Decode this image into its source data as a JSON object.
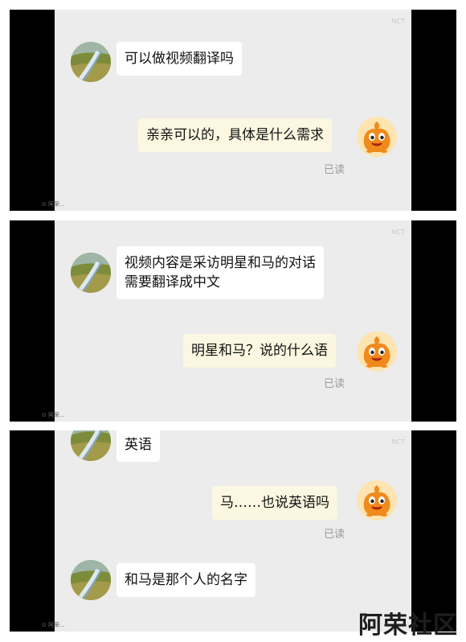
{
  "panels": [
    {
      "watermark_top": "NCT",
      "watermark_bottom": "⊙ 阿荣...",
      "messages": [
        {
          "side": "in",
          "text": "可以做视频翻译吗"
        },
        {
          "side": "out",
          "text": "亲亲可以的，具体是什么需求",
          "status": "已读"
        }
      ]
    },
    {
      "watermark_top": "NCT",
      "watermark_bottom": "⊙ 阿荣...",
      "messages": [
        {
          "side": "in",
          "line1": "视频内容是采访明星和马的对话",
          "line2": "需要翻译成中文"
        },
        {
          "side": "out",
          "text": "明星和马？说的什么语",
          "status": "已读"
        }
      ]
    },
    {
      "watermark_top": "NCT",
      "watermark_bottom": "⊙ 阿荣...",
      "messages": [
        {
          "side": "in",
          "text": "英语"
        },
        {
          "side": "out",
          "text": "马……也说英语吗",
          "status": "已读"
        },
        {
          "side": "in",
          "text": "和马是那个人的名字"
        }
      ]
    }
  ],
  "footer_brand": "阿荣社区",
  "icons": {
    "user_avatar": "landscape-avatar-icon",
    "service_avatar": "orange-mascot-avatar-icon"
  },
  "colors": {
    "chat_bg": "#ececec",
    "incoming_bubble": "#ffffff",
    "outgoing_bubble": "#fbf7e0",
    "side_bars": "#000000"
  }
}
